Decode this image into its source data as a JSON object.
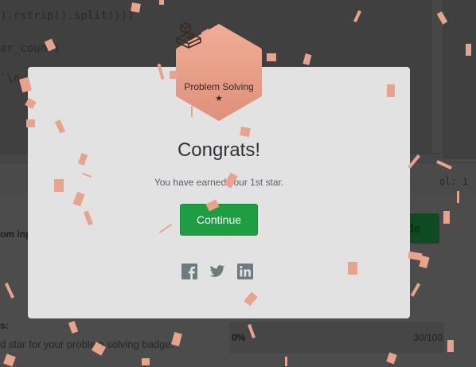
{
  "background": {
    "code_lines": [
      ").rstrip().split()))",
      "ar_coun )",
      "'\\n"
    ],
    "editor_position": "ol: 1",
    "input_label": "om inp",
    "submit_button_label": "de",
    "section_label": "s:",
    "badge_hint_text": "d star for your problem solving badge.",
    "progress_percent": "0%",
    "progress_score": "30/100",
    "progress_fraction": 0
  },
  "modal": {
    "badge": {
      "label": "Problem Solving",
      "star": "★",
      "star_count": 1,
      "icon": "puzzle-blocks-icon",
      "color_top": "#f0ad96",
      "color_bottom": "#e0907a"
    },
    "title": "Congrats!",
    "message": "You have earned your 1st star.",
    "continue_label": "Continue",
    "accent_color": "#1f9d42",
    "share_icons": [
      "facebook-icon",
      "twitter-icon",
      "linkedin-icon"
    ]
  }
}
